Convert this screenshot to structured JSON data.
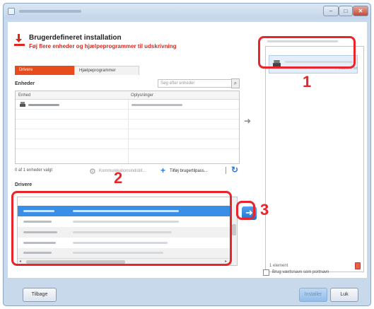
{
  "header": {
    "title": "Brugerdefineret installation",
    "subtitle": "Føj flere enheder og hjælpeprogrammer til udskrivning"
  },
  "tabs": [
    {
      "label": "Drivere",
      "active": true
    },
    {
      "label": "Hjælpeprogrammer",
      "active": false
    }
  ],
  "devices": {
    "heading": "Enheder",
    "search_placeholder": "Søg efter enheder",
    "columns": [
      "Enhed",
      "Oplysninger"
    ],
    "selection_status": "0 af 1 enheder valgt"
  },
  "toolbar": {
    "utility_label": "Kommunikationsindstill...",
    "add_custom_label": "Tilføj brugertilpass..."
  },
  "drivers": {
    "heading": "Drivere"
  },
  "right_panel": {
    "selected_tag": "Produkt / Port",
    "count_label": "1 element"
  },
  "options": {
    "checkbox_label": "Brug værtsnavn som portnavn"
  },
  "buttons": {
    "back": "Tilbage",
    "install": "Installer",
    "close": "Luk"
  },
  "callouts": {
    "one": "1",
    "two": "2",
    "three": "3"
  },
  "colors": {
    "accent_red": "#e1251b",
    "callout_red": "#e8252b",
    "selection_blue": "#3a8ee6"
  },
  "icons": [
    "download-install-icon",
    "printer-icon",
    "arrow-right-icon",
    "plus-icon",
    "refresh-icon",
    "trash-icon",
    "search-icon"
  ]
}
